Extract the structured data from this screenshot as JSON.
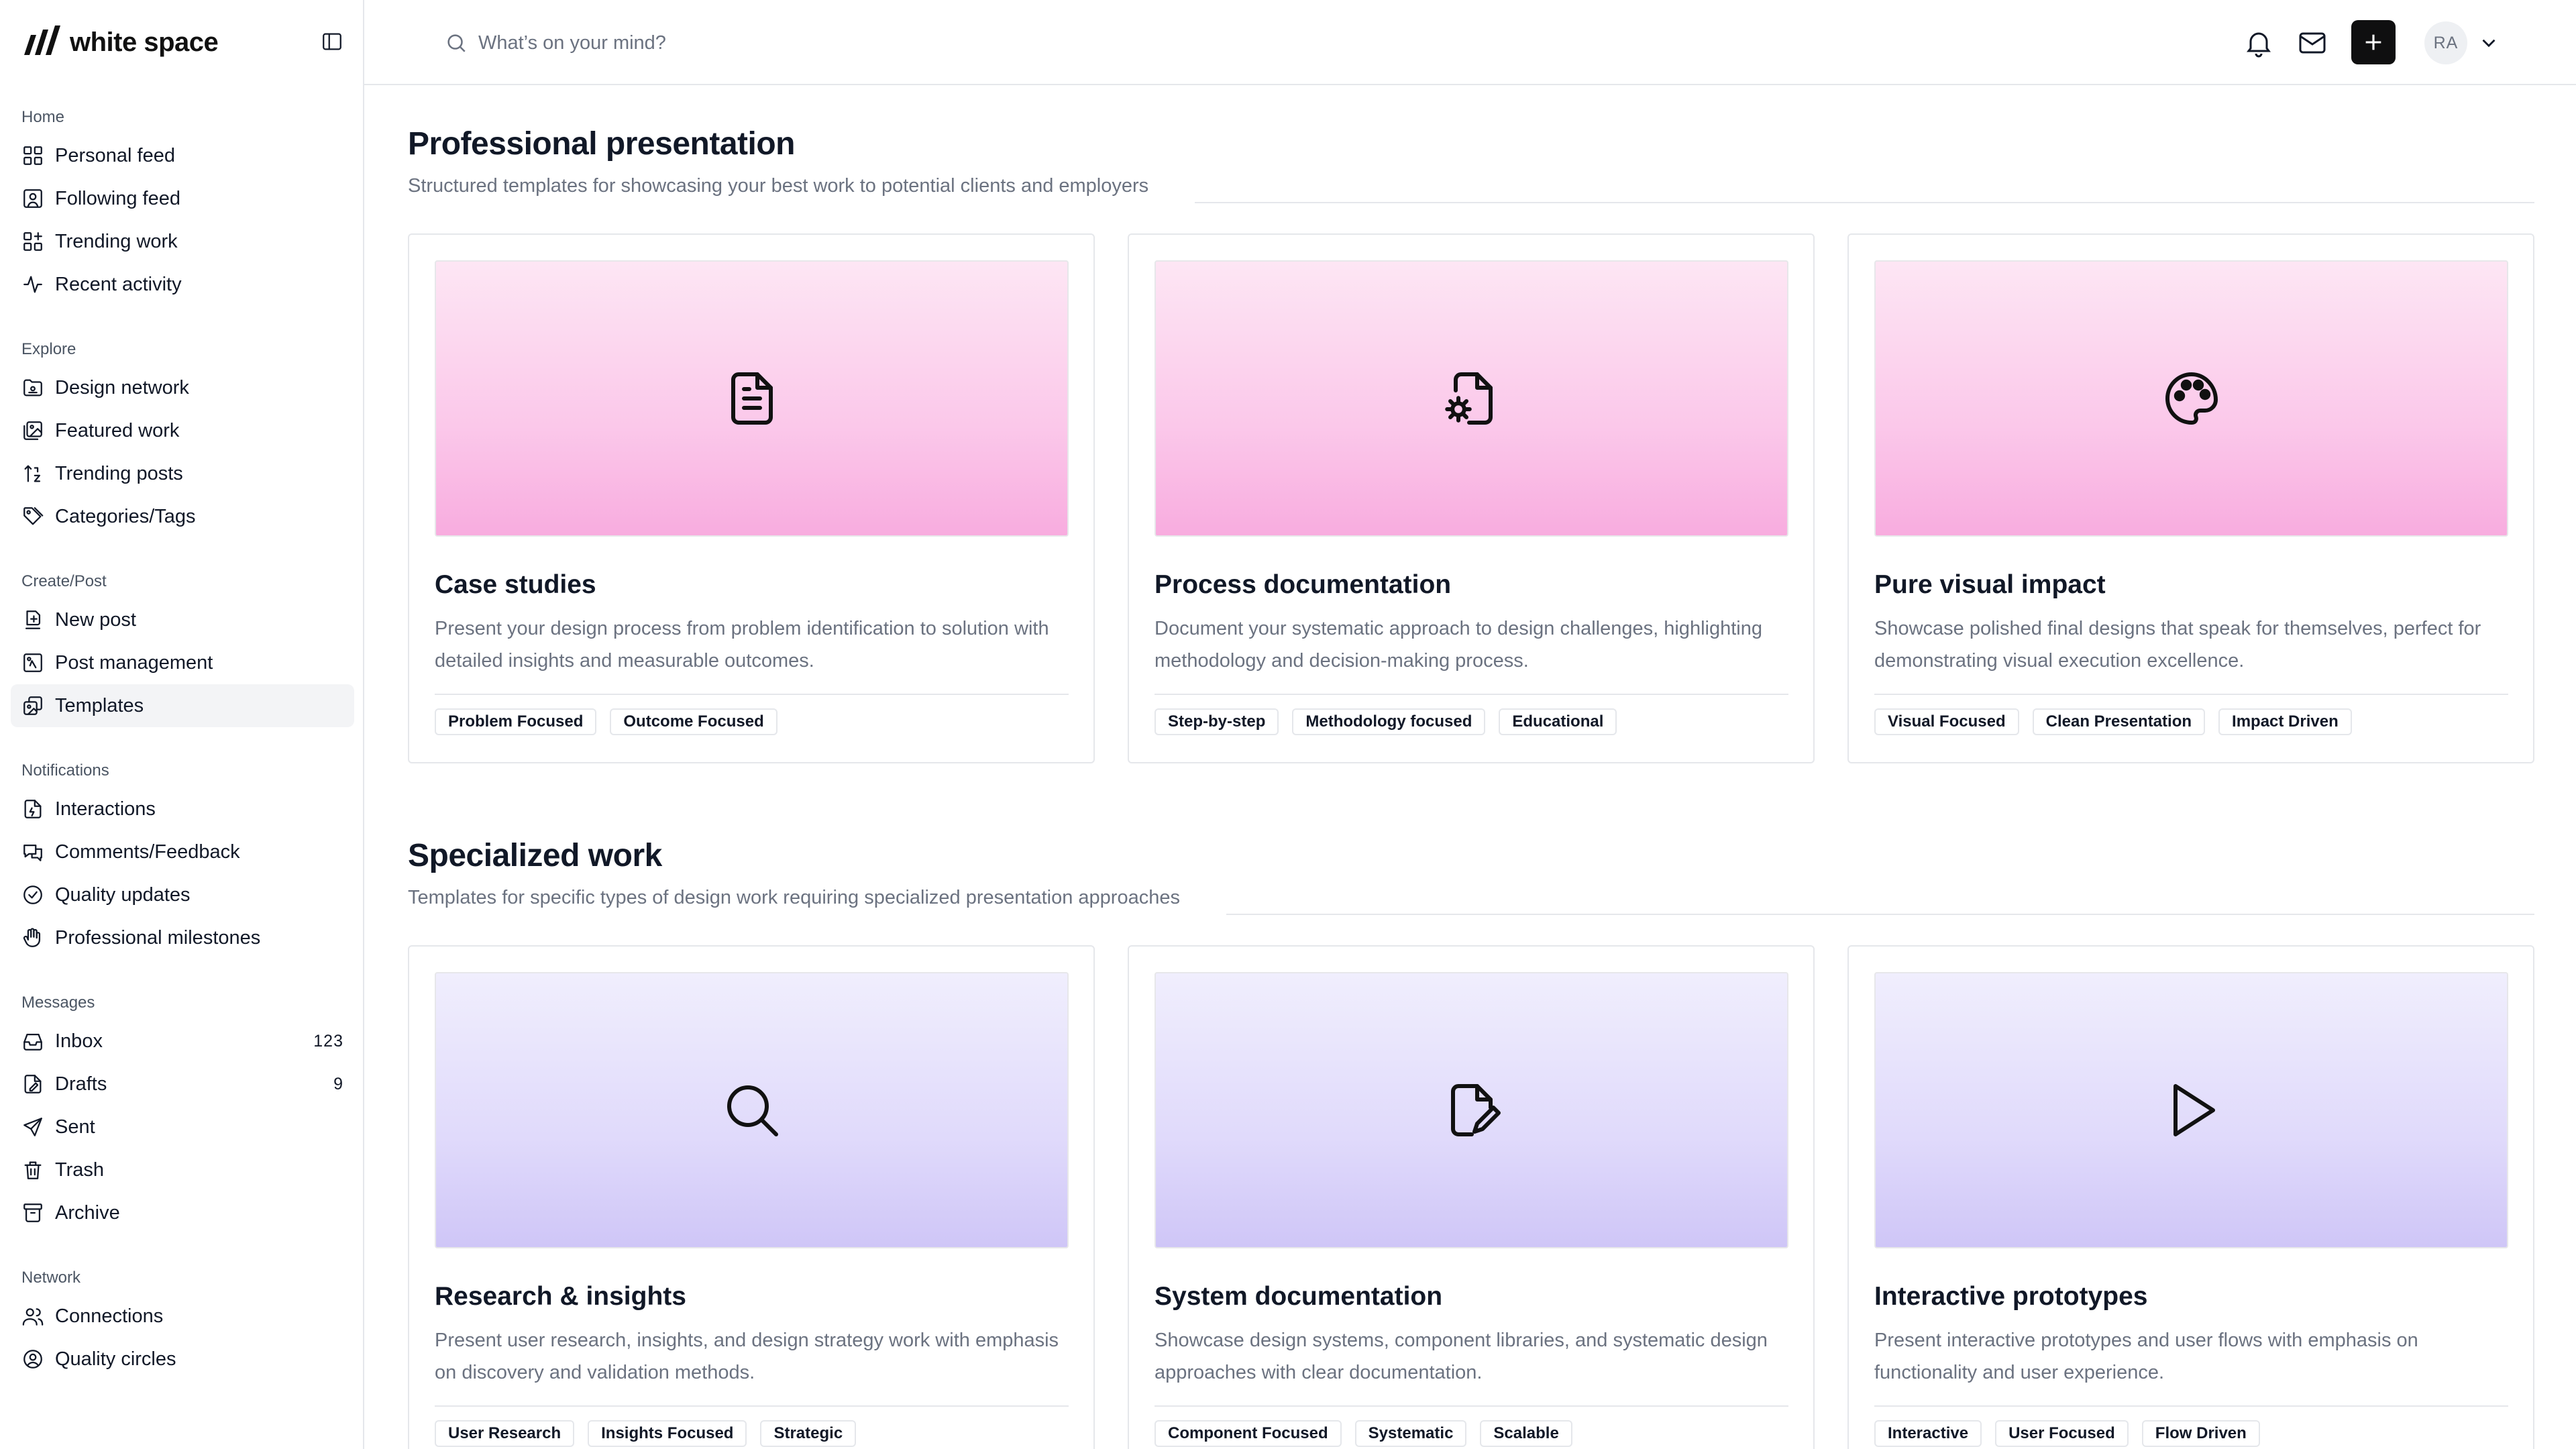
{
  "brand": {
    "name": "white space"
  },
  "sidebar": {
    "groups": [
      {
        "title": "Home",
        "items": [
          {
            "label": "Personal feed",
            "icon": "layout-grid-icon"
          },
          {
            "label": "Following feed",
            "icon": "user-square-icon"
          },
          {
            "label": "Trending work",
            "icon": "layout-grid-plus-icon"
          },
          {
            "label": "Recent activity",
            "icon": "activity-icon"
          }
        ]
      },
      {
        "title": "Explore",
        "items": [
          {
            "label": "Design network",
            "icon": "folder-network-icon"
          },
          {
            "label": "Featured work",
            "icon": "images-icon"
          },
          {
            "label": "Trending posts",
            "icon": "sort-icon"
          },
          {
            "label": "Categories/Tags",
            "icon": "tags-icon"
          }
        ]
      },
      {
        "title": "Create/Post",
        "items": [
          {
            "label": "New post",
            "icon": "new-post-icon"
          },
          {
            "label": "Post management",
            "icon": "post-management-icon"
          },
          {
            "label": "Templates",
            "icon": "templates-icon",
            "active": true
          }
        ]
      },
      {
        "title": "Notifications",
        "items": [
          {
            "label": "Interactions",
            "icon": "file-bolt-icon"
          },
          {
            "label": "Comments/Feedback",
            "icon": "comments-icon"
          },
          {
            "label": "Quality updates",
            "icon": "check-circle-icon"
          },
          {
            "label": "Professional milestones",
            "icon": "hand-icon"
          }
        ]
      },
      {
        "title": "Messages",
        "items": [
          {
            "label": "Inbox",
            "icon": "inbox-icon",
            "count": "123"
          },
          {
            "label": "Drafts",
            "icon": "drafts-icon",
            "count": "9"
          },
          {
            "label": "Sent",
            "icon": "send-icon"
          },
          {
            "label": "Trash",
            "icon": "trash-icon"
          },
          {
            "label": "Archive",
            "icon": "archive-icon"
          }
        ]
      },
      {
        "title": "Network",
        "items": [
          {
            "label": "Connections",
            "icon": "users-icon"
          },
          {
            "label": "Quality circles",
            "icon": "users-circle-icon"
          }
        ]
      }
    ]
  },
  "topbar": {
    "search_placeholder": "What’s on your mind?",
    "avatar_initials": "RA"
  },
  "sections": [
    {
      "title": "Professional presentation",
      "subtitle": "Structured templates for showcasing your best work to potential clients and employers",
      "theme": "pink",
      "cards": [
        {
          "title": "Case studies",
          "icon": "file-text-icon",
          "description": "Present your design process from problem identification to solution with detailed insights and measurable outcomes.",
          "tags": [
            "Problem Focused",
            "Outcome Focused"
          ]
        },
        {
          "title": "Process documentation",
          "icon": "file-cog-icon",
          "description": "Document your systematic approach to design challenges, highlighting methodology and decision-making process.",
          "tags": [
            "Step-by-step",
            "Methodology focused",
            "Educational"
          ]
        },
        {
          "title": "Pure visual impact",
          "icon": "palette-icon",
          "description": "Showcase polished final designs that speak for themselves, perfect for demonstrating visual execution excellence.",
          "tags": [
            "Visual Focused",
            "Clean Presentation",
            "Impact Driven"
          ]
        }
      ]
    },
    {
      "title": "Specialized work",
      "subtitle": "Templates for specific types of design work requiring specialized presentation approaches",
      "theme": "violet",
      "cards": [
        {
          "title": "Research & insights",
          "icon": "search-icon",
          "description": "Present user research, insights, and design strategy work with emphasis on discovery and validation methods.",
          "tags": [
            "User Research",
            "Insights Focused",
            "Strategic"
          ]
        },
        {
          "title": "System documentation",
          "icon": "file-pen-icon",
          "description": "Showcase design systems, component libraries, and systematic design approaches with clear documentation.",
          "tags": [
            "Component Focused",
            "Systematic",
            "Scalable"
          ]
        },
        {
          "title": "Interactive prototypes",
          "icon": "play-icon",
          "description": "Present interactive prototypes and user flows with emphasis on functionality and user experience.",
          "tags": [
            "Interactive",
            "User Focused",
            "Flow Driven"
          ]
        }
      ]
    }
  ]
}
